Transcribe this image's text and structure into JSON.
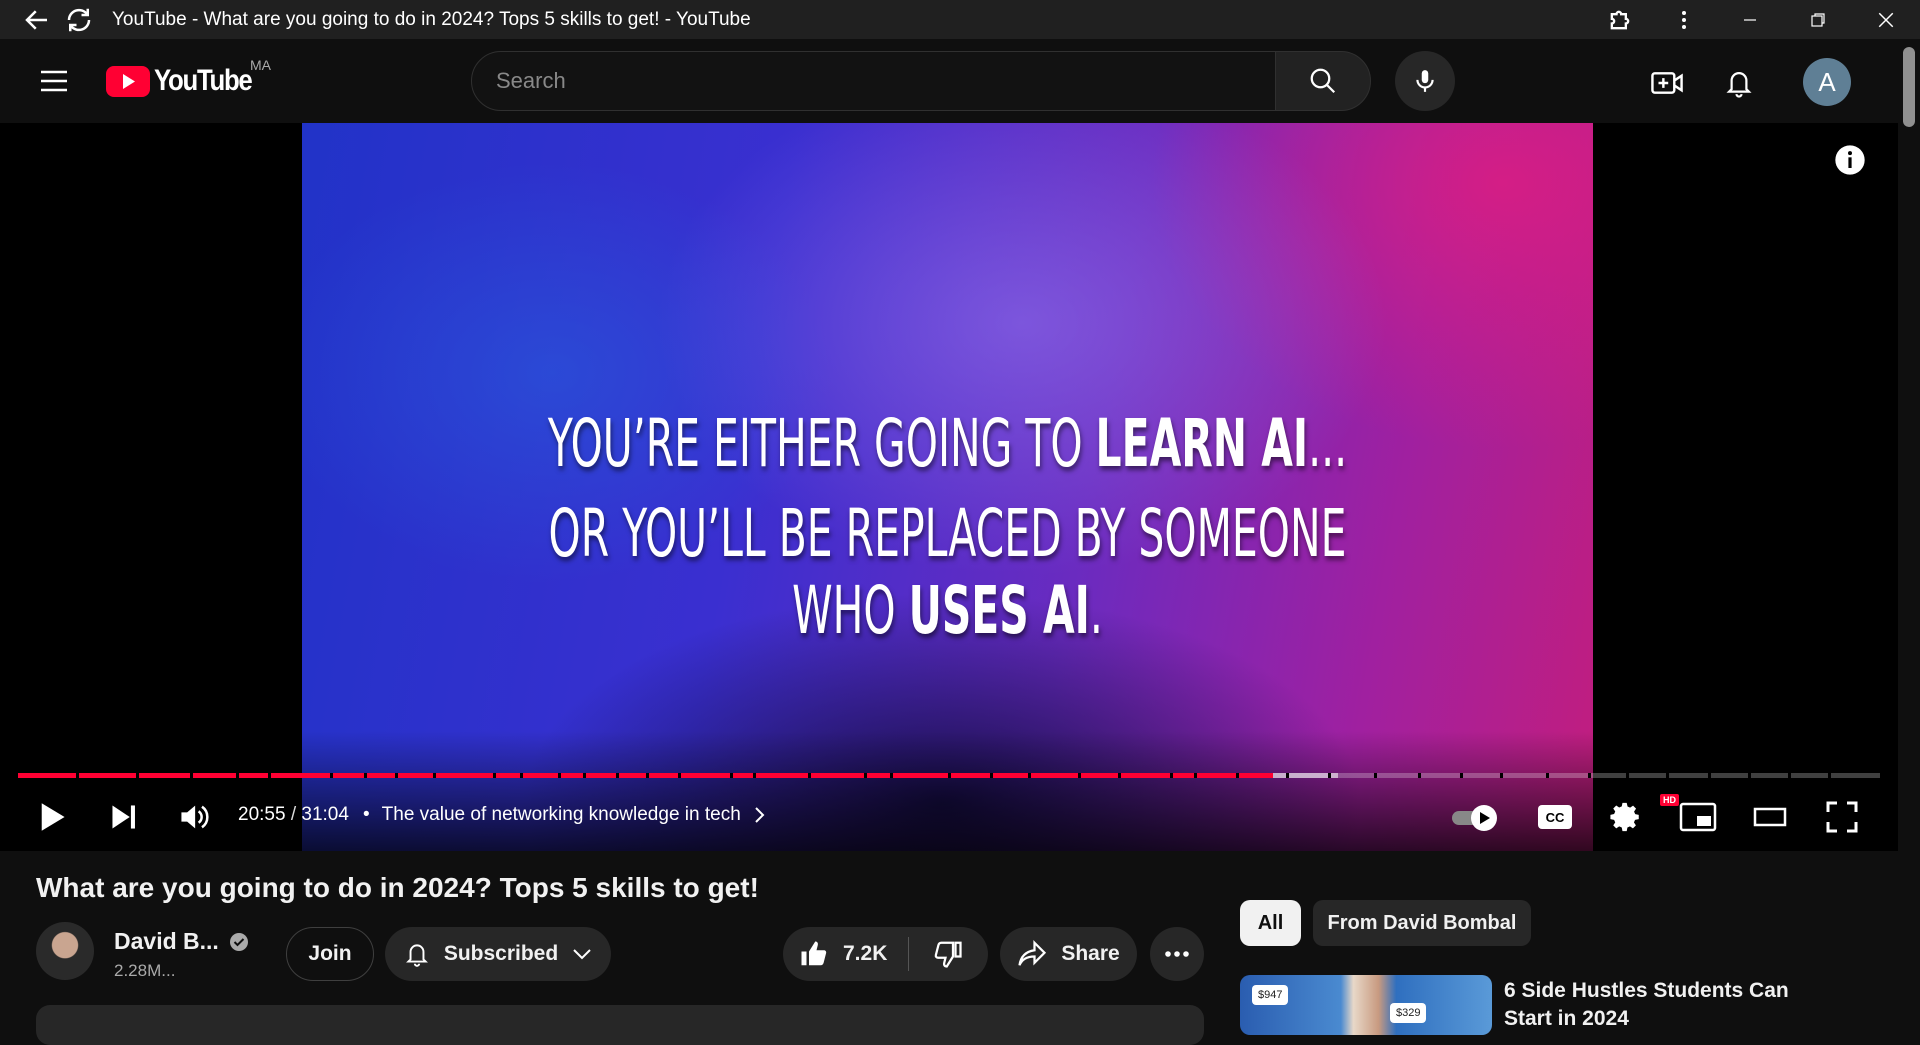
{
  "window": {
    "title": "YouTube - What are you going to do in 2024? Tops 5 skills to get! - YouTube"
  },
  "header": {
    "logo_text": "YouTube",
    "region": "MA",
    "search_placeholder": "Search",
    "avatar_letter": "A"
  },
  "player": {
    "line1_regular": "YOU’RE EITHER GOING TO ",
    "line1_bold": "LEARN AI",
    "line1_end": "...",
    "line2_regular": "OR YOU’LL BE REPLACED BY SOMEONE WHO ",
    "line2_bold": "USES AI",
    "line2_end": ".",
    "current_time": "20:55",
    "time_separator": " / ",
    "duration": "31:04",
    "bullet": "•",
    "chapter": "The value of networking knowledge in tech",
    "played_fraction": 0.674,
    "buffered_fraction": 0.709,
    "hd_badge": "HD",
    "colors": {
      "progress": "#ff0033"
    }
  },
  "video": {
    "title": "What are you going to do in 2024? Tops 5 skills to get!",
    "channel_name": "David B...",
    "subscribers": "2.28M...",
    "join_label": "Join",
    "subscribed_label": "Subscribed",
    "likes": "7.2K",
    "share_label": "Share"
  },
  "sidebar": {
    "chips": [
      "All",
      "From David Bombal"
    ],
    "recommendation": {
      "title": "6 Side Hustles Students Can Start in 2024",
      "thumb_value_1": "$947",
      "thumb_value_2": "$329"
    }
  }
}
